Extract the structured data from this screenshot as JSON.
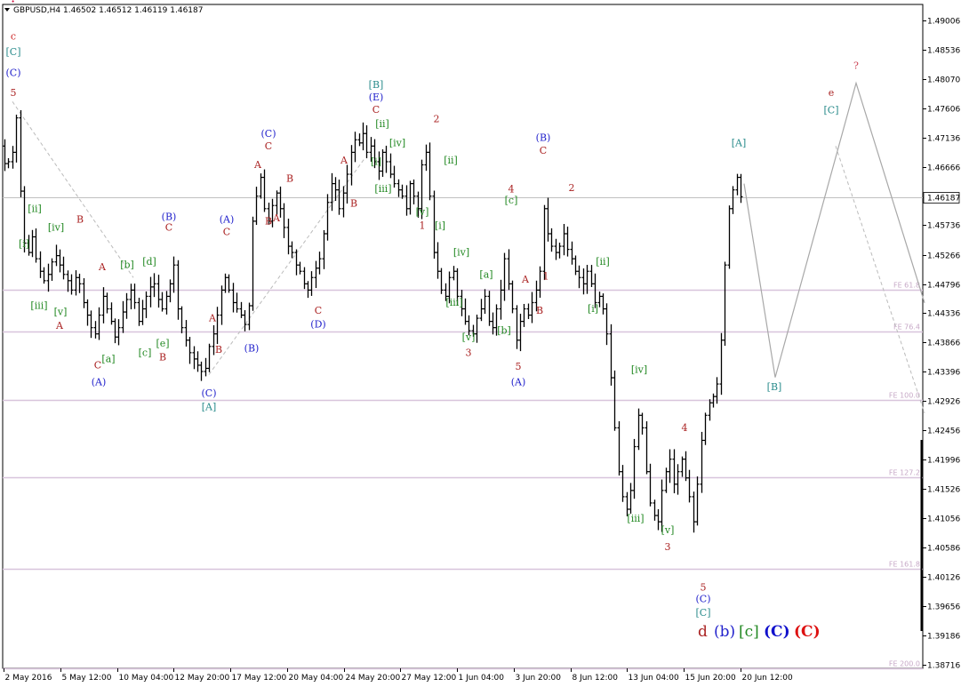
{
  "chart_data": {
    "type": "candlestick",
    "title": "GBPUSD,H4  1.46502 1.46512 1.46119 1.46187",
    "symbol": "GBPUSD,H4",
    "ohlc": [
      "1.46502",
      "1.46512",
      "1.46119",
      "1.46187"
    ],
    "ylim": [
      1.3835,
      1.5
    ],
    "y_ticks": [
      "1.49006",
      "1.48536",
      "1.48070",
      "1.47606",
      "1.47136",
      "1.46666",
      "1.46187",
      "1.45736",
      "1.45266",
      "1.44796",
      "1.44336",
      "1.43866",
      "1.43396",
      "1.42926",
      "1.42456",
      "1.41996",
      "1.41526",
      "1.41056",
      "1.40586",
      "1.40126",
      "1.39656",
      "1.39186",
      "1.38716"
    ],
    "y_tick_values": [
      1.49006,
      1.48536,
      1.4807,
      1.47606,
      1.47136,
      1.46666,
      1.46187,
      1.45736,
      1.45266,
      1.44796,
      1.44336,
      1.43866,
      1.43396,
      1.42926,
      1.42456,
      1.41996,
      1.41526,
      1.41056,
      1.40586,
      1.40126,
      1.39656,
      1.39186,
      1.38716
    ],
    "current_price": 1.46187,
    "x_ticks": [
      "2 May 2016",
      "5 May 12:00",
      "10 May 04:00",
      "12 May 20:00",
      "17 May 12:00",
      "20 May 04:00",
      "24 May 20:00",
      "27 May 12:00",
      "1 Jun 04:00",
      "3 Jun 20:00",
      "8 Jun 12:00",
      "13 Jun 04:00",
      "15 Jun 20:00",
      "20 Jun 12:00"
    ],
    "fib_levels": [
      {
        "label": "FE 61.8",
        "value": 1.44706
      },
      {
        "label": "FE 76.4",
        "value": 1.44036
      },
      {
        "label": "FE 100.0",
        "value": 1.42946
      },
      {
        "label": "FE 127.2",
        "value": 1.41716
      },
      {
        "label": "FE 161.8",
        "value": 1.40246
      },
      {
        "label": "FE 200.0",
        "value": 1.38656
      }
    ],
    "closes": [
      1.4672,
      1.4675,
      1.469,
      1.4745,
      1.4628,
      1.4545,
      1.453,
      1.4555,
      1.452,
      1.45,
      1.4485,
      1.4495,
      1.4515,
      1.4525,
      1.451,
      1.4495,
      1.4485,
      1.447,
      1.449,
      1.448,
      1.445,
      1.443,
      1.441,
      1.44,
      1.443,
      1.446,
      1.444,
      1.442,
      1.4395,
      1.441,
      1.4435,
      1.4455,
      1.447,
      1.445,
      1.442,
      1.444,
      1.446,
      1.4475,
      1.448,
      1.4455,
      1.444,
      1.446,
      1.448,
      1.451,
      1.444,
      1.441,
      1.439,
      1.437,
      1.436,
      1.435,
      1.434,
      1.4345,
      1.438,
      1.44,
      1.443,
      1.447,
      1.449,
      1.447,
      1.445,
      1.444,
      1.443,
      1.4415,
      1.4445,
      1.458,
      1.462,
      1.465,
      1.46,
      1.458,
      1.4605,
      1.4625,
      1.46,
      1.457,
      1.454,
      1.453,
      1.451,
      1.45,
      1.448,
      1.447,
      1.449,
      1.4505,
      1.452,
      1.456,
      1.461,
      1.464,
      1.463,
      1.46,
      1.4625,
      1.4655,
      1.469,
      1.471,
      1.4705,
      1.472,
      1.469,
      1.47,
      1.4675,
      1.466,
      1.469,
      1.4675,
      1.4655,
      1.464,
      1.463,
      1.462,
      1.46,
      1.464,
      1.462,
      1.46,
      1.467,
      1.469,
      1.462,
      1.453,
      1.45,
      1.447,
      1.446,
      1.449,
      1.45,
      1.446,
      1.444,
      1.442,
      1.4405,
      1.44,
      1.4425,
      1.444,
      1.446,
      1.442,
      1.441,
      1.444,
      1.447,
      1.452,
      1.448,
      1.444,
      1.439,
      1.442,
      1.444,
      1.443,
      1.445,
      1.447,
      1.45,
      1.46,
      1.456,
      1.454,
      1.453,
      1.454,
      1.456,
      1.4535,
      1.452,
      1.45,
      1.449,
      1.448,
      1.45,
      1.448,
      1.445,
      1.446,
      1.444,
      1.44,
      1.433,
      1.425,
      1.418,
      1.414,
      1.412,
      1.415,
      1.422,
      1.427,
      1.425,
      1.418,
      1.413,
      1.411,
      1.41,
      1.415,
      1.418,
      1.42,
      1.416,
      1.418,
      1.42,
      1.417,
      1.414,
      1.41,
      1.416,
      1.423,
      1.427,
      1.429,
      1.43,
      1.432,
      1.439,
      1.451,
      1.46,
      1.463,
      1.465,
      1.4619
    ],
    "price_start": 1.47,
    "projection": [
      [
        837,
        1.464
      ],
      [
        872,
        1.43306
      ],
      [
        963,
        1.48006
      ],
      [
        1040,
        1.44496
      ]
    ],
    "projection_dashed": [
      [
        940,
        1.47
      ],
      [
        1040,
        1.42736
      ]
    ],
    "dashed_channels": [
      [
        [
          14,
          1.4771
        ],
        [
          150,
          1.449
        ]
      ],
      [
        [
          235,
          1.4335
        ],
        [
          410,
          1.468
        ]
      ]
    ],
    "wave_labels": [
      {
        "text": "?",
        "x": 15,
        "y": 1.493,
        "color": "#cc0033",
        "size": 16,
        "bold": true
      },
      {
        "text": "c",
        "x": 15,
        "y": 1.487,
        "color": "#cc2222",
        "size": 14
      },
      {
        "text": "[C]",
        "x": 15,
        "y": 1.4845,
        "color": "#2a8c8c"
      },
      {
        "text": "(C)",
        "x": 15,
        "y": 1.4812,
        "color": "#2222cc"
      },
      {
        "text": "5",
        "x": 15,
        "y": 1.478,
        "color": "#aa2222"
      },
      {
        "text": "[ii]",
        "x": 39,
        "y": 1.4595,
        "color": "#228822"
      },
      {
        "text": "[i]",
        "x": 27,
        "y": 1.4539,
        "color": "#228822"
      },
      {
        "text": "[iv]",
        "x": 63,
        "y": 1.4565,
        "color": "#228822"
      },
      {
        "text": "B",
        "x": 90,
        "y": 1.4578,
        "color": "#aa2222"
      },
      {
        "text": "[iii]",
        "x": 44,
        "y": 1.444,
        "color": "#228822"
      },
      {
        "text": "[v]",
        "x": 68,
        "y": 1.443,
        "color": "#228822"
      },
      {
        "text": "A",
        "x": 67,
        "y": 1.4408,
        "color": "#aa2222"
      },
      {
        "text": "A",
        "x": 115,
        "y": 1.4502,
        "color": "#aa2222"
      },
      {
        "text": "[b]",
        "x": 143,
        "y": 1.4505,
        "color": "#228822"
      },
      {
        "text": "[d]",
        "x": 168,
        "y": 1.451,
        "color": "#228822"
      },
      {
        "text": "(B)",
        "x": 190,
        "y": 1.4582,
        "color": "#2222cc"
      },
      {
        "text": "C",
        "x": 190,
        "y": 1.4565,
        "color": "#aa2222"
      },
      {
        "text": "[a]",
        "x": 122,
        "y": 1.4355,
        "color": "#228822"
      },
      {
        "text": "C",
        "x": 110,
        "y": 1.4345,
        "color": "#aa2222"
      },
      {
        "text": "(A)",
        "x": 111,
        "y": 1.4318,
        "color": "#2222cc"
      },
      {
        "text": "[c]",
        "x": 163,
        "y": 1.4365,
        "color": "#228822"
      },
      {
        "text": "[e]",
        "x": 183,
        "y": 1.438,
        "color": "#228822"
      },
      {
        "text": "B",
        "x": 183,
        "y": 1.4358,
        "color": "#aa2222"
      },
      {
        "text": "(A)",
        "x": 255,
        "y": 1.4578,
        "color": "#2222cc"
      },
      {
        "text": "C",
        "x": 255,
        "y": 1.4558,
        "color": "#aa2222"
      },
      {
        "text": "A",
        "x": 239,
        "y": 1.442,
        "color": "#aa2222"
      },
      {
        "text": "B",
        "x": 246,
        "y": 1.437,
        "color": "#aa2222"
      },
      {
        "text": "(B)",
        "x": 283,
        "y": 1.4372,
        "color": "#2222cc"
      },
      {
        "text": "(C)",
        "x": 235,
        "y": 1.43,
        "color": "#2222cc"
      },
      {
        "text": "[A]",
        "x": 235,
        "y": 1.4278,
        "color": "#2a8c8c"
      },
      {
        "text": "(C)",
        "x": 302,
        "y": 1.4715,
        "color": "#2222cc"
      },
      {
        "text": "C",
        "x": 302,
        "y": 1.4695,
        "color": "#aa2222"
      },
      {
        "text": "A",
        "x": 290,
        "y": 1.4665,
        "color": "#aa2222"
      },
      {
        "text": "B",
        "x": 326,
        "y": 1.4643,
        "color": "#aa2222"
      },
      {
        "text": "B",
        "x": 302,
        "y": 1.4575,
        "color": "#aa2222"
      },
      {
        "text": "A",
        "x": 311,
        "y": 1.458,
        "color": "#aa2222"
      },
      {
        "text": "C",
        "x": 358,
        "y": 1.4432,
        "color": "#aa2222"
      },
      {
        "text": "(D)",
        "x": 358,
        "y": 1.441,
        "color": "#2222cc"
      },
      {
        "text": "A",
        "x": 387,
        "y": 1.4672,
        "color": "#aa2222"
      },
      {
        "text": "B",
        "x": 398,
        "y": 1.4603,
        "color": "#aa2222"
      },
      {
        "text": "[B]",
        "x": 423,
        "y": 1.4793,
        "color": "#2a8c8c"
      },
      {
        "text": "(E)",
        "x": 423,
        "y": 1.4773,
        "color": "#2222cc"
      },
      {
        "text": "C",
        "x": 423,
        "y": 1.4753,
        "color": "#aa2222"
      },
      {
        "text": "[ii]",
        "x": 430,
        "y": 1.473,
        "color": "#228822"
      },
      {
        "text": "[iv]",
        "x": 447,
        "y": 1.47,
        "color": "#228822"
      },
      {
        "text": "[i]",
        "x": 423,
        "y": 1.467,
        "color": "#228822"
      },
      {
        "text": "[iii]",
        "x": 431,
        "y": 1.4627,
        "color": "#228822"
      },
      {
        "text": "2",
        "x": 491,
        "y": 1.4738,
        "color": "#aa2222"
      },
      {
        "text": "[ii]",
        "x": 507,
        "y": 1.4672,
        "color": "#228822"
      },
      {
        "text": "[v]",
        "x": 475,
        "y": 1.459,
        "color": "#228822"
      },
      {
        "text": "1",
        "x": 475,
        "y": 1.4568,
        "color": "#aa2222"
      },
      {
        "text": "[i]",
        "x": 495,
        "y": 1.4568,
        "color": "#228822"
      },
      {
        "text": "[iv]",
        "x": 519,
        "y": 1.4525,
        "color": "#228822"
      },
      {
        "text": "[iii]",
        "x": 511,
        "y": 1.4445,
        "color": "#228822"
      },
      {
        "text": "[a]",
        "x": 547,
        "y": 1.449,
        "color": "#228822"
      },
      {
        "text": "[v]",
        "x": 527,
        "y": 1.439,
        "color": "#228822"
      },
      {
        "text": "3",
        "x": 527,
        "y": 1.4365,
        "color": "#aa2222"
      },
      {
        "text": "[b]",
        "x": 567,
        "y": 1.44,
        "color": "#228822"
      },
      {
        "text": "4",
        "x": 575,
        "y": 1.4626,
        "color": "#aa2222"
      },
      {
        "text": "[c]",
        "x": 575,
        "y": 1.4608,
        "color": "#228822"
      },
      {
        "text": "A",
        "x": 591,
        "y": 1.4482,
        "color": "#aa2222"
      },
      {
        "text": "1",
        "x": 614,
        "y": 1.4487,
        "color": "#aa2222"
      },
      {
        "text": "B",
        "x": 607,
        "y": 1.4432,
        "color": "#aa2222"
      },
      {
        "text": "5",
        "x": 583,
        "y": 1.4343,
        "color": "#aa2222"
      },
      {
        "text": "(A)",
        "x": 583,
        "y": 1.4318,
        "color": "#2222cc"
      },
      {
        "text": "(B)",
        "x": 611,
        "y": 1.4708,
        "color": "#2222cc"
      },
      {
        "text": "C",
        "x": 611,
        "y": 1.4688,
        "color": "#aa2222"
      },
      {
        "text": "2",
        "x": 643,
        "y": 1.4628,
        "color": "#aa2222"
      },
      {
        "text": "[ii]",
        "x": 678,
        "y": 1.451,
        "color": "#228822"
      },
      {
        "text": "[i]",
        "x": 667,
        "y": 1.4435,
        "color": "#228822"
      },
      {
        "text": "[iv]",
        "x": 719,
        "y": 1.4338,
        "color": "#228822"
      },
      {
        "text": "4",
        "x": 770,
        "y": 1.4245,
        "color": "#aa2222"
      },
      {
        "text": "[iii]",
        "x": 715,
        "y": 1.41,
        "color": "#228822"
      },
      {
        "text": "[v]",
        "x": 751,
        "y": 1.4082,
        "color": "#228822"
      },
      {
        "text": "3",
        "x": 751,
        "y": 1.4055,
        "color": "#aa2222"
      },
      {
        "text": "5",
        "x": 791,
        "y": 1.399,
        "color": "#aa2222"
      },
      {
        "text": "(C)",
        "x": 791,
        "y": 1.3972,
        "color": "#2222cc"
      },
      {
        "text": "[C]",
        "x": 791,
        "y": 1.395,
        "color": "#2a8c8c"
      },
      {
        "text": "[A]",
        "x": 831,
        "y": 1.47,
        "color": "#2a8c8c"
      },
      {
        "text": "[B]",
        "x": 871,
        "y": 1.431,
        "color": "#2a8c8c"
      },
      {
        "text": "?",
        "x": 963,
        "y": 1.4823,
        "color": "#cc4455",
        "size": 13
      },
      {
        "text": "e",
        "x": 935,
        "y": 1.478,
        "color": "#aa2222",
        "size": 15
      },
      {
        "text": "[C]",
        "x": 935,
        "y": 1.4752,
        "color": "#2a8c8c"
      }
    ],
    "legend": [
      {
        "text": "d",
        "color": "#aa2222"
      },
      {
        "text": "(b)",
        "color": "#2222cc"
      },
      {
        "text": "[c]",
        "color": "#228822"
      },
      {
        "text": "(C)",
        "color": "#1111cc",
        "bold": true
      },
      {
        "text": "(C)",
        "color": "#dd1111",
        "bold": true
      }
    ]
  }
}
